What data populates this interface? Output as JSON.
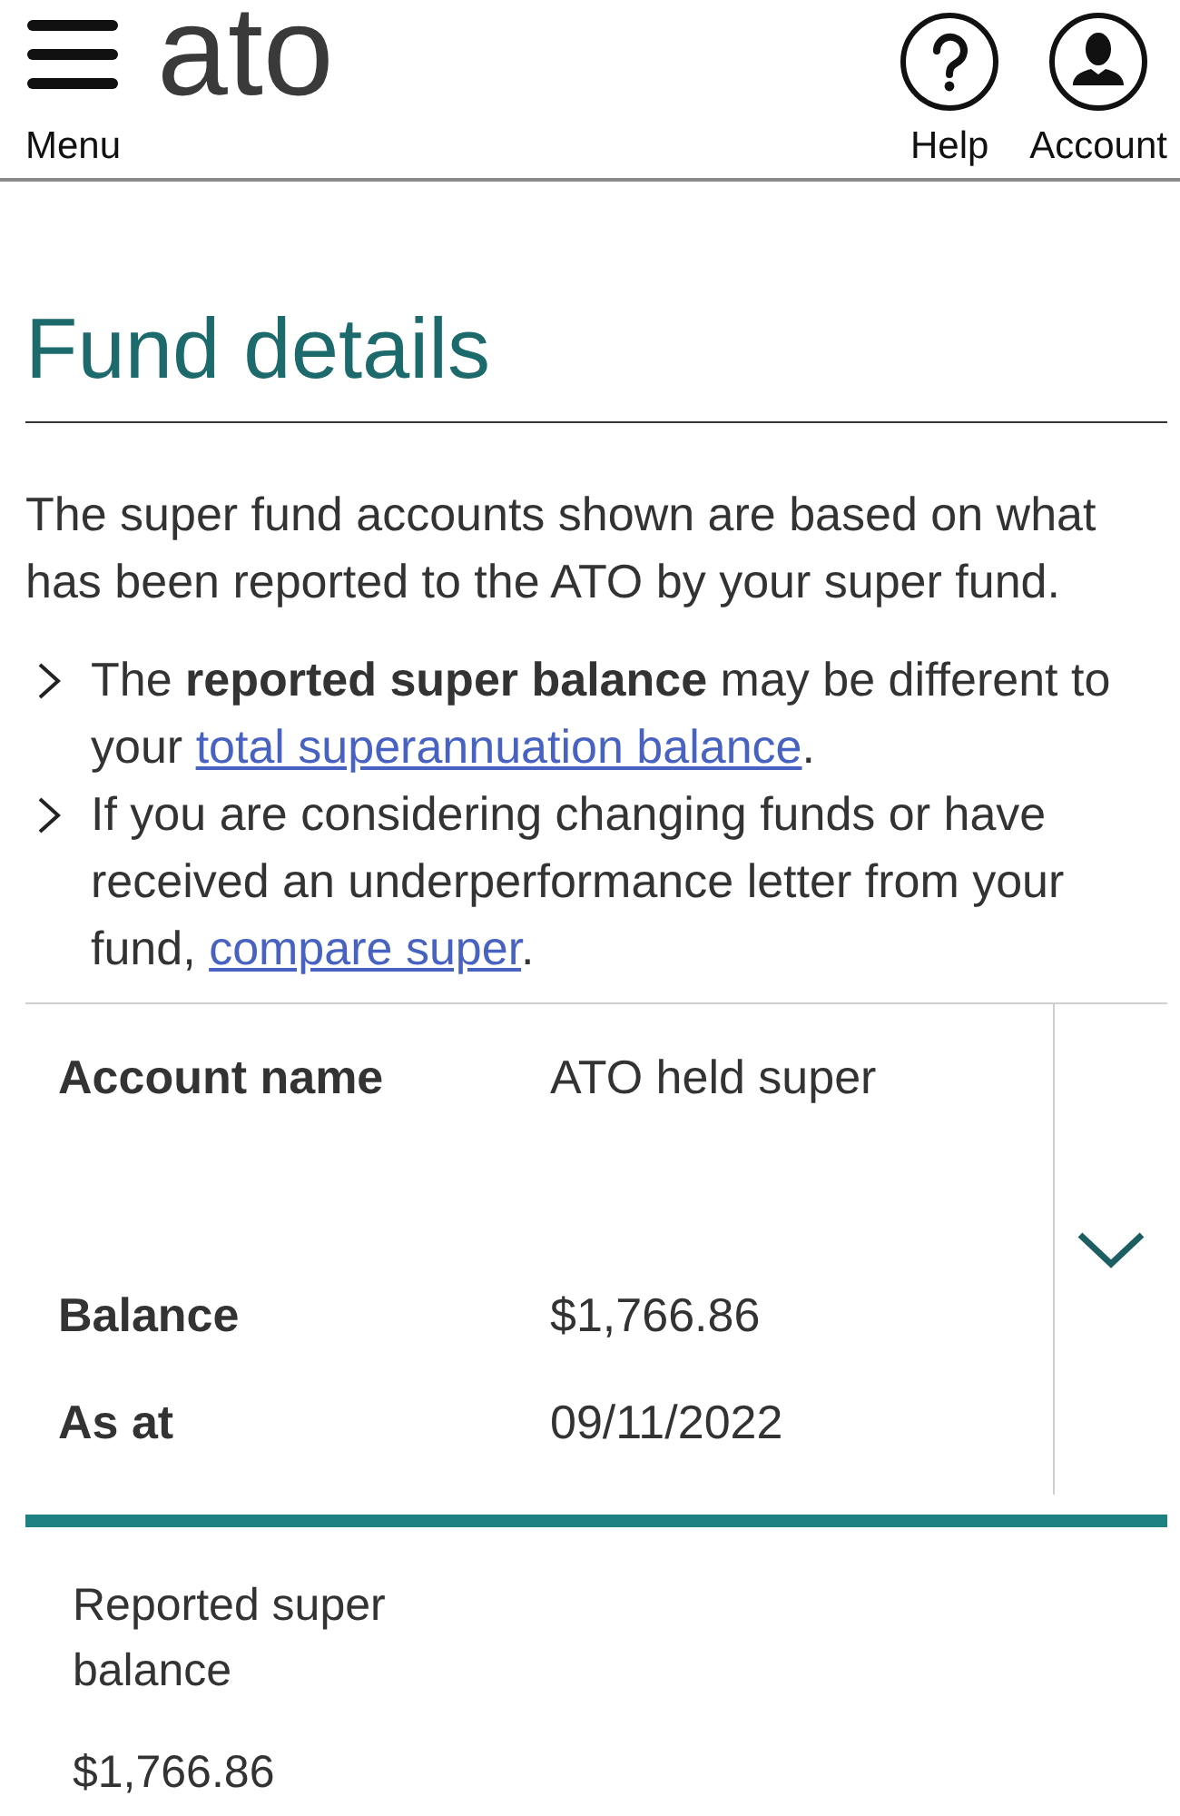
{
  "header": {
    "logo": "ato",
    "menu_label": "Menu",
    "actions": [
      {
        "kind": "help",
        "label": "Help"
      },
      {
        "kind": "account",
        "label": "Account"
      }
    ]
  },
  "page_title": "Fund details",
  "intro": "The super fund accounts shown are based on what has been reported to the ATO by your super fund.",
  "notes": [
    {
      "parts": [
        {
          "kind": "text",
          "text": "The **reported super balance** may be different to your "
        },
        {
          "kind": "link",
          "text": "total superannuation balance"
        },
        {
          "kind": "text",
          "text": "."
        }
      ]
    },
    {
      "parts": [
        {
          "kind": "text",
          "text": "If you are considering changing funds or have received an underperformance letter from your fund, "
        },
        {
          "kind": "link",
          "text": "compare super"
        },
        {
          "kind": "text",
          "text": "."
        }
      ]
    }
  ],
  "account_card": {
    "expanded": false,
    "rows": [
      {
        "label": "Account name",
        "value": "ATO held super"
      },
      {
        "label": "Balance",
        "value": "$1,766.86"
      },
      {
        "label": "As at",
        "value": "09/11/2022"
      }
    ]
  },
  "reported_balance": {
    "label": "Reported super balance",
    "value": "$1,766.86"
  }
}
